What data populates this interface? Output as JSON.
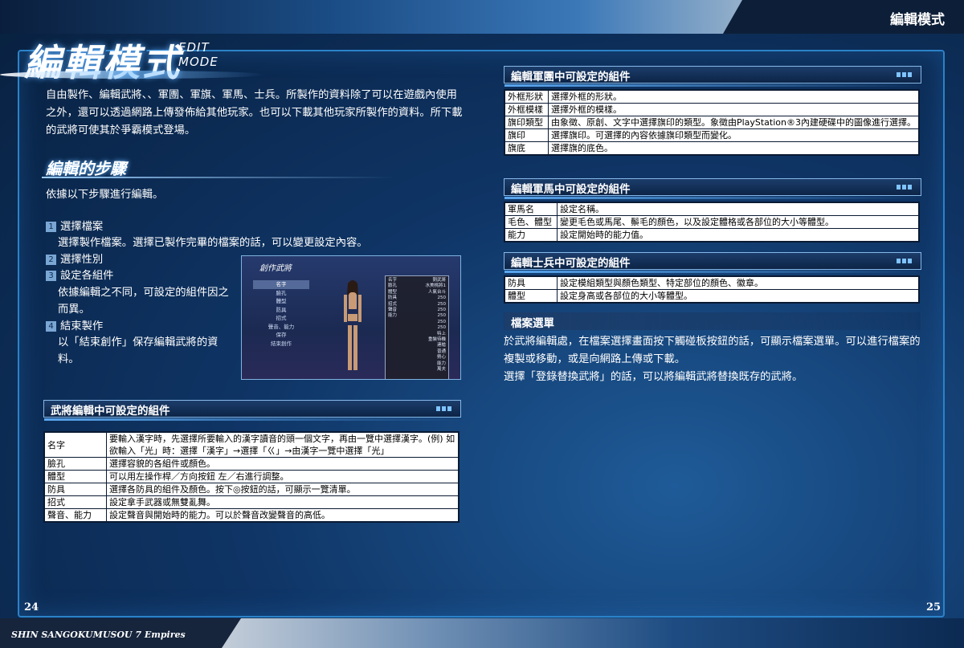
{
  "header": {
    "chip": "編輯模式"
  },
  "title": {
    "main": "編輯模式",
    "sub": "EDIT MODE"
  },
  "intro": "自由製作、編輯武將、、軍團、軍旗、軍馬、士兵。所製作的資料除了可以在遊戲內使用之外，還可以透過網路上傳發佈給其他玩家。也可以下載其他玩家所製作的資料。所下載的武將可使其於爭霸模式登場。",
  "steps_section": {
    "heading": "編輯的步驟",
    "lead": "依據以下步驟進行編輯。",
    "steps": [
      {
        "num": "1",
        "title": "選擇檔案",
        "desc": "選擇製作檔案。選擇已製作完畢的檔案的話，可以變更設定內容。"
      },
      {
        "num": "2",
        "title": "選擇性別",
        "desc": ""
      },
      {
        "num": "3",
        "title": "設定各組件",
        "desc": "依據編輯之不同，可設定的組件因之而異。"
      },
      {
        "num": "4",
        "title": "結束製作",
        "desc": "以「結束創作」保存編輯武將的資料。"
      }
    ]
  },
  "screenshot": {
    "menu_title": "創作武將",
    "menu": [
      "名字",
      "臉孔",
      "體型",
      "防具",
      "招式",
      "聲音、能力",
      "保存",
      "結束創作"
    ],
    "status": [
      [
        "名字",
        "劉武將"
      ],
      [
        "臉孔",
        "水美桃將1"
      ],
      [
        "體型",
        "人氣台斗"
      ],
      [
        "防具",
        "250"
      ],
      [
        "招式",
        "250"
      ],
      [
        "聲音",
        "250"
      ],
      [
        "能力",
        "250"
      ],
      [
        "",
        "250"
      ],
      [
        "",
        "250"
      ],
      [
        "",
        "特上"
      ],
      [
        "",
        "重裝待機"
      ],
      [
        "",
        "連槍"
      ],
      [
        "",
        "普通"
      ],
      [
        "",
        "勢心"
      ],
      [
        "",
        "能力"
      ],
      [
        "",
        "萬夫"
      ]
    ]
  },
  "general_table": {
    "heading": "武將編輯中可設定的組件",
    "rows": [
      [
        "名字",
        "要輸入漢字時，先選擇所要輸入的漢字讀音的頭一個文字，再由一覽中選擇漢字。(例) 如欲輸入「光」時：選擇「漢字」→選擇「ㄍ」→由漢字一覽中選擇「光」"
      ],
      [
        "臉孔",
        "選擇容貌的各組件或顏色。"
      ],
      [
        "體型",
        "可以用左操作桿／方向按鈕 左／右進行調整。"
      ],
      [
        "防具",
        "選擇各防具的組件及顏色。按下◎按鈕的話，可顯示一覽清單。"
      ],
      [
        "招式",
        "設定拿手武器或無雙亂舞。"
      ],
      [
        "聲音、能力",
        "設定聲音與開始時的能力。可以於聲音改變聲音的高低。"
      ]
    ]
  },
  "army_table": {
    "heading": "編輯軍團中可設定的組件",
    "rows": [
      [
        "外框形狀",
        "選擇外框的形狀。"
      ],
      [
        "外框模樣",
        "選擇外框的模樣。"
      ],
      [
        "旗印類型",
        "由象徵、原創、文字中選擇旗印的類型。象徵由PlayStation®3內建硬碟中的圖像進行選擇。"
      ],
      [
        "旗印",
        "選擇旗印。可選擇的內容依據旗印類型而變化。"
      ],
      [
        "旗底",
        "選擇旗的底色。"
      ]
    ]
  },
  "horse_table": {
    "heading": "編輯軍馬中可設定的組件",
    "rows": [
      [
        "軍馬名",
        "設定名稱。"
      ],
      [
        "毛色、體型",
        "變更毛色或馬尾、鬃毛的顏色，以及設定體格或各部位的大小等體型。"
      ],
      [
        "能力",
        "設定開始時的能力值。"
      ]
    ]
  },
  "soldier_table": {
    "heading": "編輯士兵中可設定的組件",
    "rows": [
      [
        "防具",
        "設定模組類型與顏色類型、特定部位的顏色、徽章。"
      ],
      [
        "體型",
        "設定身高或各部位的大小等體型。"
      ]
    ]
  },
  "file_section": {
    "heading": "檔案選單",
    "lines": [
      "於武將編輯處，在檔案選擇畫面按下觸碰板按鈕的話，可顯示檔案選單。可以進行檔案的複製或移動，或是向網路上傳或下載。",
      "選擇「登錄替換武將」的話，可以將編輯武將替換既存的武將。"
    ]
  },
  "footer": {
    "game_title": "SHIN SANGOKUMUSOU 7 Empires",
    "page_left": "24",
    "page_right": "25"
  },
  "colors": {
    "background": "#0f3566",
    "frame": "#2b82c8",
    "table_bg": "#ffffff"
  }
}
